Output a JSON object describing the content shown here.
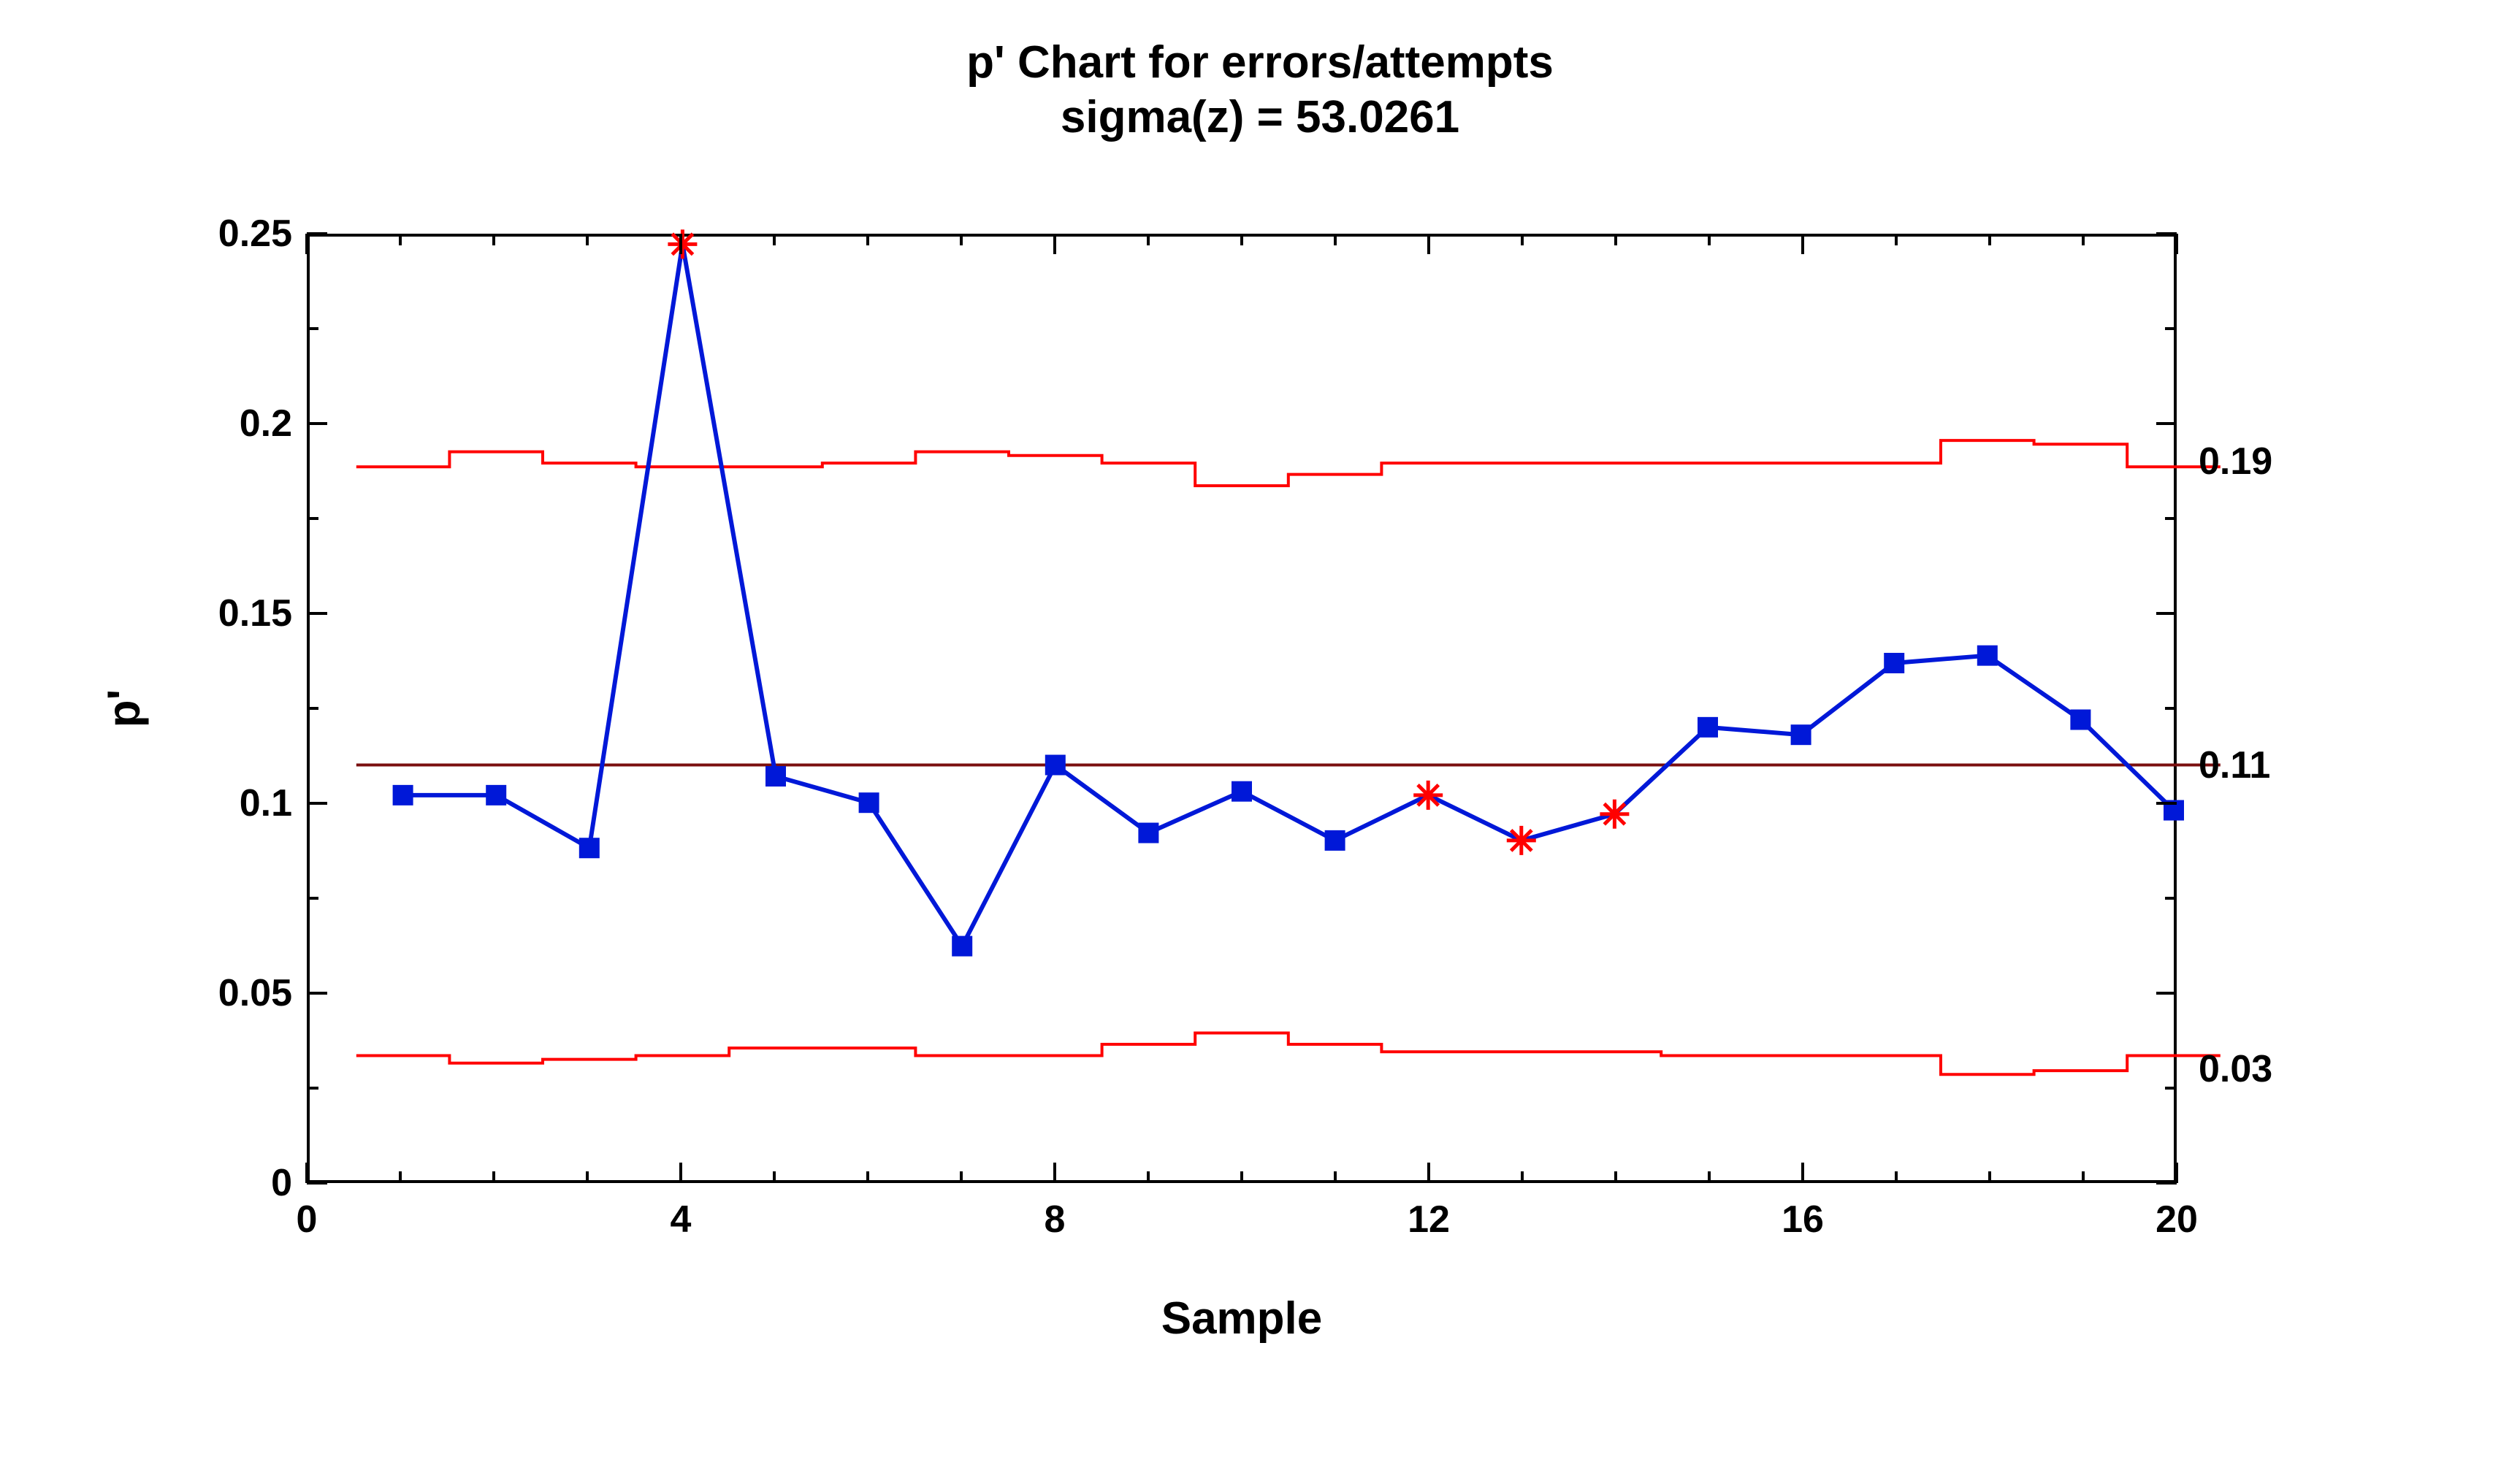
{
  "chart_data": {
    "type": "line",
    "title": "p' Chart for errors/attempts",
    "subtitle": "sigma(z) = 53.0261",
    "xlabel": "Sample",
    "ylabel": "p'",
    "xlim": [
      0,
      20
    ],
    "ylim": [
      0,
      0.25
    ],
    "y_ticks": [
      0,
      0.05,
      0.1,
      0.15,
      0.2,
      0.25
    ],
    "x_ticks": [
      0,
      4,
      8,
      12,
      16,
      20
    ],
    "x_minor_ticks": [
      1,
      2,
      3,
      5,
      6,
      7,
      9,
      10,
      11,
      13,
      14,
      15,
      17,
      18,
      19
    ],
    "centerline": 0.11,
    "right_labels": {
      "ucl": 0.19,
      "cl": 0.11,
      "lcl": 0.03
    },
    "ucl_steps": [
      {
        "x": 0.5,
        "y": 0.189
      },
      {
        "x": 1.5,
        "y": 0.189
      },
      {
        "x": 1.5,
        "y": 0.193
      },
      {
        "x": 2.5,
        "y": 0.193
      },
      {
        "x": 2.5,
        "y": 0.19
      },
      {
        "x": 3.5,
        "y": 0.19
      },
      {
        "x": 3.5,
        "y": 0.189
      },
      {
        "x": 4.5,
        "y": 0.189
      },
      {
        "x": 4.5,
        "y": 0.189
      },
      {
        "x": 5.5,
        "y": 0.189
      },
      {
        "x": 5.5,
        "y": 0.19
      },
      {
        "x": 6.5,
        "y": 0.19
      },
      {
        "x": 6.5,
        "y": 0.193
      },
      {
        "x": 7.5,
        "y": 0.193
      },
      {
        "x": 7.5,
        "y": 0.192
      },
      {
        "x": 8.5,
        "y": 0.192
      },
      {
        "x": 8.5,
        "y": 0.19
      },
      {
        "x": 9.5,
        "y": 0.19
      },
      {
        "x": 9.5,
        "y": 0.184
      },
      {
        "x": 10.5,
        "y": 0.184
      },
      {
        "x": 10.5,
        "y": 0.187
      },
      {
        "x": 11.5,
        "y": 0.187
      },
      {
        "x": 11.5,
        "y": 0.19
      },
      {
        "x": 12.5,
        "y": 0.19
      },
      {
        "x": 12.5,
        "y": 0.19
      },
      {
        "x": 13.5,
        "y": 0.19
      },
      {
        "x": 13.5,
        "y": 0.19
      },
      {
        "x": 14.5,
        "y": 0.19
      },
      {
        "x": 14.5,
        "y": 0.19
      },
      {
        "x": 15.5,
        "y": 0.19
      },
      {
        "x": 15.5,
        "y": 0.19
      },
      {
        "x": 16.5,
        "y": 0.19
      },
      {
        "x": 16.5,
        "y": 0.19
      },
      {
        "x": 17.5,
        "y": 0.19
      },
      {
        "x": 17.5,
        "y": 0.196
      },
      {
        "x": 18.5,
        "y": 0.196
      },
      {
        "x": 18.5,
        "y": 0.195
      },
      {
        "x": 19.5,
        "y": 0.195
      },
      {
        "x": 19.5,
        "y": 0.189
      },
      {
        "x": 20.5,
        "y": 0.189
      }
    ],
    "lcl_steps": [
      {
        "x": 0.5,
        "y": 0.033
      },
      {
        "x": 1.5,
        "y": 0.033
      },
      {
        "x": 1.5,
        "y": 0.031
      },
      {
        "x": 2.5,
        "y": 0.031
      },
      {
        "x": 2.5,
        "y": 0.032
      },
      {
        "x": 3.5,
        "y": 0.032
      },
      {
        "x": 3.5,
        "y": 0.033
      },
      {
        "x": 4.5,
        "y": 0.033
      },
      {
        "x": 4.5,
        "y": 0.035
      },
      {
        "x": 5.5,
        "y": 0.035
      },
      {
        "x": 5.5,
        "y": 0.035
      },
      {
        "x": 6.5,
        "y": 0.035
      },
      {
        "x": 6.5,
        "y": 0.033
      },
      {
        "x": 7.5,
        "y": 0.033
      },
      {
        "x": 7.5,
        "y": 0.033
      },
      {
        "x": 8.5,
        "y": 0.033
      },
      {
        "x": 8.5,
        "y": 0.036
      },
      {
        "x": 9.5,
        "y": 0.036
      },
      {
        "x": 9.5,
        "y": 0.039
      },
      {
        "x": 10.5,
        "y": 0.039
      },
      {
        "x": 10.5,
        "y": 0.036
      },
      {
        "x": 11.5,
        "y": 0.036
      },
      {
        "x": 11.5,
        "y": 0.034
      },
      {
        "x": 12.5,
        "y": 0.034
      },
      {
        "x": 12.5,
        "y": 0.034
      },
      {
        "x": 13.5,
        "y": 0.034
      },
      {
        "x": 13.5,
        "y": 0.034
      },
      {
        "x": 14.5,
        "y": 0.034
      },
      {
        "x": 14.5,
        "y": 0.033
      },
      {
        "x": 15.5,
        "y": 0.033
      },
      {
        "x": 15.5,
        "y": 0.033
      },
      {
        "x": 16.5,
        "y": 0.033
      },
      {
        "x": 16.5,
        "y": 0.033
      },
      {
        "x": 17.5,
        "y": 0.033
      },
      {
        "x": 17.5,
        "y": 0.028
      },
      {
        "x": 18.5,
        "y": 0.028
      },
      {
        "x": 18.5,
        "y": 0.029
      },
      {
        "x": 19.5,
        "y": 0.029
      },
      {
        "x": 19.5,
        "y": 0.033
      },
      {
        "x": 20.5,
        "y": 0.033
      }
    ],
    "series": [
      {
        "name": "p'",
        "x": [
          1,
          2,
          3,
          4,
          5,
          6,
          7,
          8,
          9,
          10,
          11,
          12,
          13,
          14,
          15,
          16,
          17,
          18,
          19,
          20
        ],
        "values": [
          0.102,
          0.102,
          0.088,
          0.248,
          0.107,
          0.1,
          0.062,
          0.11,
          0.092,
          0.103,
          0.09,
          0.102,
          0.09,
          0.097,
          0.12,
          0.118,
          0.137,
          0.139,
          0.122,
          0.098
        ],
        "marker": [
          "square",
          "square",
          "square",
          "star",
          "square",
          "square",
          "square",
          "square",
          "square",
          "square",
          "square",
          "star",
          "star",
          "star",
          "square",
          "square",
          "square",
          "square",
          "square",
          "square"
        ]
      }
    ]
  }
}
